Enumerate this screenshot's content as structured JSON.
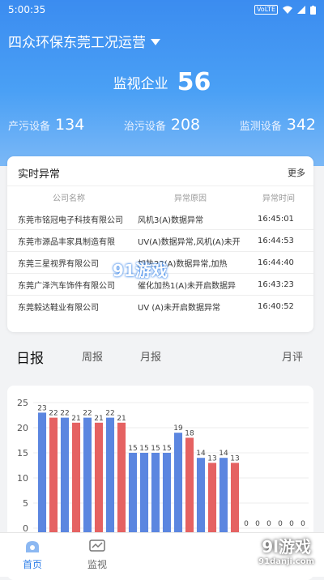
{
  "status_bar": {
    "time": "5:00:35",
    "network": "VoLTE"
  },
  "header": {
    "title": "四众环保东莞工况运营"
  },
  "summary": {
    "monitor_label": "监视企业",
    "monitor_count": "56",
    "stats": [
      {
        "label": "产污设备",
        "value": "134"
      },
      {
        "label": "治污设备",
        "value": "208"
      },
      {
        "label": "监测设备",
        "value": "342"
      }
    ]
  },
  "alarms": {
    "title": "实时异常",
    "more": "更多",
    "columns": [
      "公司名称",
      "异常原因",
      "异常时间"
    ],
    "rows": [
      {
        "company": "东莞市铭冠电子科技有限公司",
        "reason": "风机3(A)数据异常",
        "time": "16:45:01"
      },
      {
        "company": "东莞市源品丰家具制造有限",
        "reason": "UV(A)数据异常,风机(A)未开",
        "time": "16:44:53"
      },
      {
        "company": "东莞三星视界有限公司",
        "reason": "加热22(A)数据异常,加热",
        "time": "16:44:40"
      },
      {
        "company": "东莞广泽汽车饰件有限公司",
        "reason": "催化加热1(A)未开启数据异",
        "time": "16:43:23"
      },
      {
        "company": "东莞毅达鞋业有限公司",
        "reason": "UV (A)未开启数据异常",
        "time": "16:40:52"
      }
    ]
  },
  "tabs": {
    "daily": "日报",
    "weekly": "周报",
    "monthly": "月报",
    "monthly_review": "月评"
  },
  "chart_data": {
    "type": "bar",
    "ylim": [
      0,
      25
    ],
    "yticks": [
      0,
      5,
      10,
      15,
      20,
      25
    ],
    "grid": true,
    "colors": {
      "blue": "#5b86e0",
      "red": "#e56262"
    },
    "bars": [
      {
        "value": 23,
        "color": "blue"
      },
      {
        "value": 22,
        "color": "red"
      },
      {
        "value": 22,
        "color": "blue"
      },
      {
        "value": 21,
        "color": "red"
      },
      {
        "value": 22,
        "color": "blue"
      },
      {
        "value": 21,
        "color": "red"
      },
      {
        "value": 22,
        "color": "blue"
      },
      {
        "value": 21,
        "color": "red"
      },
      {
        "value": 15,
        "color": "blue"
      },
      {
        "value": 15,
        "color": "blue"
      },
      {
        "value": 15,
        "color": "blue"
      },
      {
        "value": 15,
        "color": "blue"
      },
      {
        "value": 19,
        "color": "blue"
      },
      {
        "value": 18,
        "color": "red"
      },
      {
        "value": 14,
        "color": "blue"
      },
      {
        "value": 13,
        "color": "red"
      },
      {
        "value": 14,
        "color": "blue"
      },
      {
        "value": 13,
        "color": "red"
      },
      {
        "value": 0,
        "color": "blue"
      },
      {
        "value": 0,
        "color": "blue"
      },
      {
        "value": 0,
        "color": "blue"
      },
      {
        "value": 0,
        "color": "blue"
      },
      {
        "value": 0,
        "color": "blue"
      },
      {
        "value": 0,
        "color": "blue"
      }
    ]
  },
  "bottom_nav": {
    "items": [
      {
        "label": "首页",
        "icon": "home-icon",
        "active": true
      },
      {
        "label": "监视",
        "icon": "monitor-icon",
        "active": false
      }
    ]
  },
  "watermarks": {
    "center": "91游戏",
    "corner_title": "9l游戏",
    "corner_url": "91danji.com"
  }
}
